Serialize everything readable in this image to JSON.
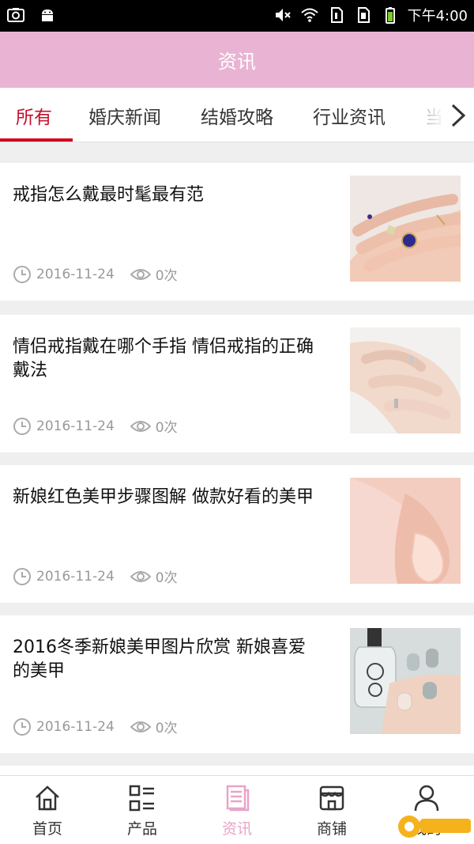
{
  "status_bar": {
    "time": "下午4:00",
    "icons": [
      "screenshot-icon",
      "android-icon",
      "mute-icon",
      "wifi-icon",
      "sim1-icon",
      "sim2-icon",
      "battery-icon"
    ]
  },
  "header": {
    "title": "资讯"
  },
  "tabs": [
    {
      "label": "所有",
      "active": true
    },
    {
      "label": "婚庆新闻",
      "active": false
    },
    {
      "label": "结婚攻略",
      "active": false
    },
    {
      "label": "行业资讯",
      "active": false
    },
    {
      "label": "当",
      "active": false
    }
  ],
  "articles": [
    {
      "title": "戒指怎么戴最时髦最有范",
      "date": "2016-11-24",
      "views": "0次",
      "thumbnail": "rings-on-hand"
    },
    {
      "title": "情侣戒指戴在哪个手指 情侣戒指的正确戴法",
      "date": "2016-11-24",
      "views": "0次",
      "thumbnail": "couple-hands-rings"
    },
    {
      "title": "新娘红色美甲步骤图解 做款好看的美甲",
      "date": "2016-11-24",
      "views": "0次",
      "thumbnail": "pink-nail"
    },
    {
      "title": "2016冬季新娘美甲图片欣赏 新娘喜爱的美甲",
      "date": "2016-11-24",
      "views": "0次",
      "thumbnail": "nail-polish-bottle"
    }
  ],
  "bottom_nav": [
    {
      "label": "首页",
      "icon": "home-icon",
      "active": false
    },
    {
      "label": "产品",
      "icon": "grid-list-icon",
      "active": false
    },
    {
      "label": "资讯",
      "icon": "document-icon",
      "active": true
    },
    {
      "label": "商铺",
      "icon": "shop-icon",
      "active": false
    },
    {
      "label": "我的",
      "icon": "user-icon",
      "active": false
    }
  ],
  "colors": {
    "header_bg": "#e9b4d3",
    "active_tab": "#c8102e",
    "active_nav": "#e9a4c8",
    "meta_text": "#999999"
  }
}
